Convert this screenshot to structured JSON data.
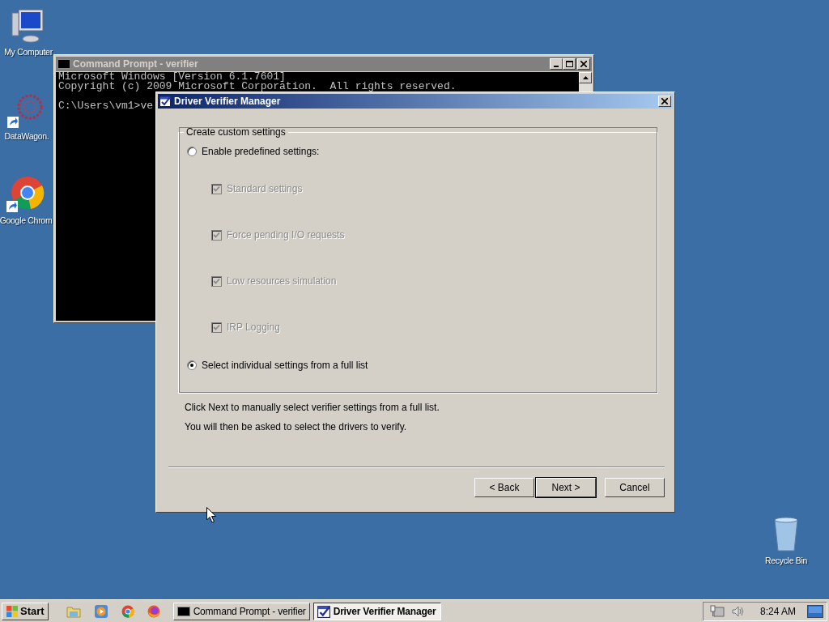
{
  "desktop_icons": [
    {
      "label": "My Computer",
      "kind": "computer",
      "shortcut": false
    },
    {
      "label": "DataWagon.",
      "kind": "network",
      "shortcut": true
    },
    {
      "label": "Google Chrom",
      "kind": "browser",
      "shortcut": true
    },
    {
      "label": "Recycle Bin",
      "kind": "bin",
      "shortcut": false
    }
  ],
  "console_window": {
    "title": "Command Prompt - verifier",
    "lines": [
      "Microsoft Windows [Version 6.1.7601]",
      "Copyright (c) 2009 Microsoft Corporation.  All rights reserved.",
      "C:\\Users\\vm1>ve"
    ]
  },
  "dialog": {
    "title": "Driver Verifier Manager",
    "group_label": "Create custom settings",
    "options": [
      {
        "kind": "radio",
        "label": "Enable predefined settings:",
        "selected": false,
        "disabled": false
      },
      {
        "kind": "checkbox",
        "label": "Standard settings",
        "checked": true,
        "disabled": true
      },
      {
        "kind": "checkbox",
        "label": "Force pending I/O requests",
        "checked": true,
        "disabled": true
      },
      {
        "kind": "checkbox",
        "label": "Low resources simulation",
        "checked": true,
        "disabled": true
      },
      {
        "kind": "checkbox",
        "label": "IRP Logging",
        "checked": true,
        "disabled": true
      },
      {
        "kind": "radio",
        "label": "Select individual settings from a full list",
        "selected": true,
        "disabled": false
      }
    ],
    "notes": [
      "Click Next to manually select verifier settings from a full list.",
      "You will then be asked to select the drivers to verify."
    ],
    "buttons": [
      {
        "label": "< Back",
        "default": false
      },
      {
        "label": "Next >",
        "default": true
      },
      {
        "label": "Cancel",
        "default": false
      }
    ]
  },
  "taskbar": {
    "start": "Start",
    "tasks": [
      {
        "label": "Command Prompt - verifier",
        "kind": "console",
        "selected": false
      },
      {
        "label": "Driver Verifier Manager",
        "kind": "verifier",
        "selected": true
      }
    ],
    "clock": "8:24 AM"
  }
}
